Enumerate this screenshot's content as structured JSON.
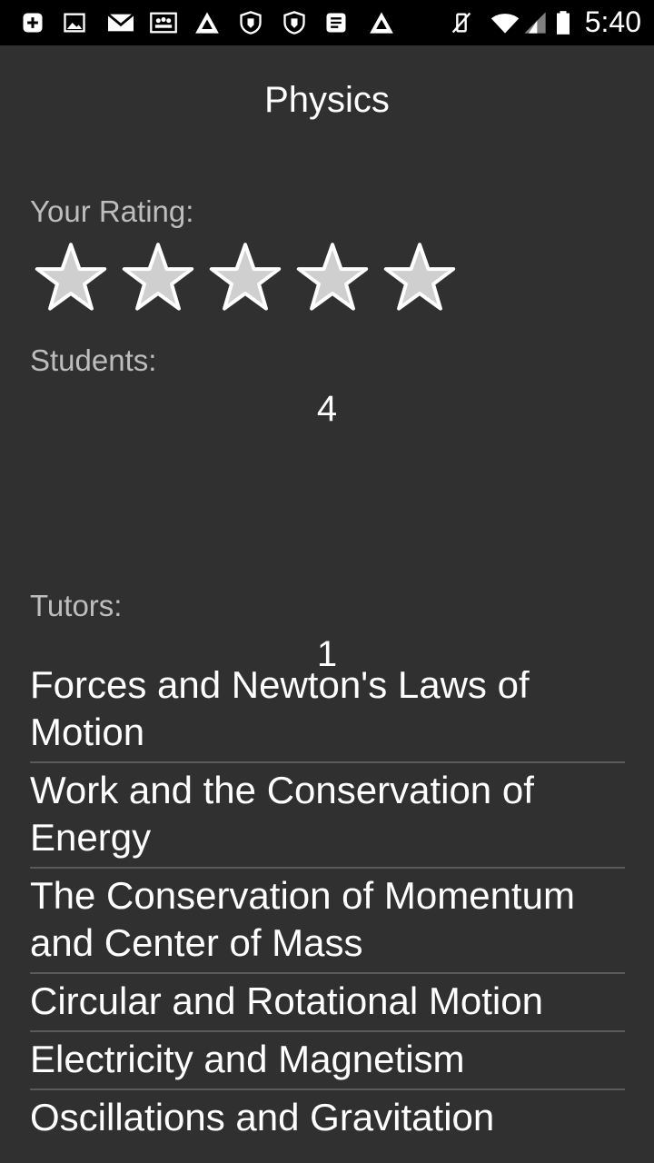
{
  "status_bar": {
    "time": "5:40",
    "notification_icons": [
      "plus-square-icon",
      "image-icon",
      "gmail-icon",
      "group-icon",
      "triangle-logo-icon",
      "shield-hand-icon",
      "shield-hand-icon",
      "document-icon",
      "triangle-logo-icon"
    ],
    "system_icons": [
      "vibrate-off-icon",
      "wifi-icon",
      "signal-icon",
      "battery-icon"
    ]
  },
  "page": {
    "title": "Physics"
  },
  "rating": {
    "label": "Your Rating:",
    "value": 0,
    "max": 5
  },
  "students": {
    "label": "Students:",
    "count": "4"
  },
  "tutors": {
    "label": "Tutors:",
    "count": "1"
  },
  "topics": [
    "Forces and Newton's Laws of Motion",
    "Work and the Conservation of Energy",
    "The Conservation of Momentum and Center of Mass",
    "Circular and Rotational Motion",
    "Electricity and Magnetism",
    "Oscillations and Gravitation"
  ],
  "colors": {
    "background": "#303030",
    "status_bar": "#000000",
    "label": "#bdbdbd",
    "star_fill": "#cfcfcf",
    "divider": "#5a5a5a"
  }
}
